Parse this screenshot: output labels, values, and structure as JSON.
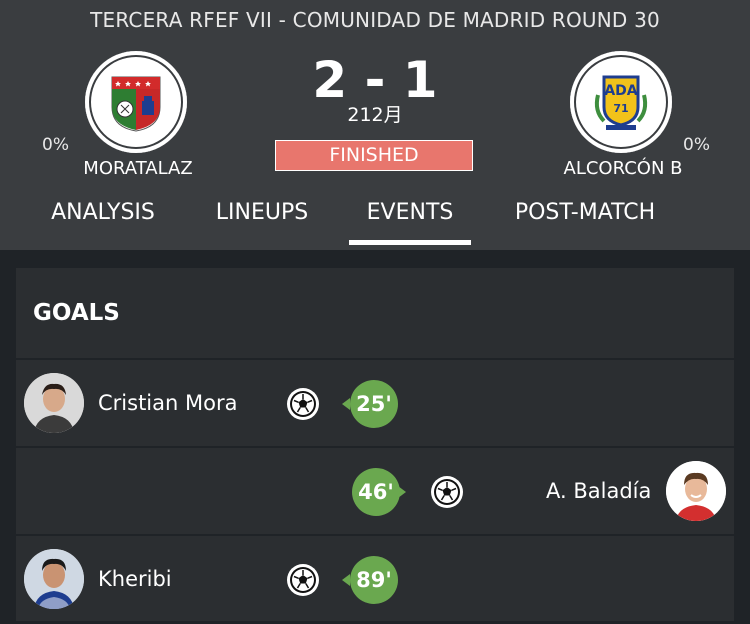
{
  "competition": {
    "title": "TERCERA RFEF  VII - COMUNIDAD DE MADRID ROUND 30"
  },
  "home": {
    "name": "MORATALAZ",
    "percent": "0%",
    "crest_icon": "moratalaz-crest"
  },
  "away": {
    "name": "ALCORCÓN B",
    "percent": "0%",
    "crest_icon": "alcorcon-crest"
  },
  "match": {
    "score": "2 - 1",
    "date": "212月",
    "status": "FINISHED"
  },
  "tabs": [
    {
      "label": "ANALYSIS"
    },
    {
      "label": "LINEUPS"
    },
    {
      "label": "EVENTS",
      "active": true
    },
    {
      "label": "POST-MATCH"
    }
  ],
  "events": {
    "section_title": "GOALS",
    "goals": [
      {
        "player": "Cristian Mora",
        "minute": "25'",
        "side": "home"
      },
      {
        "player": "A. Baladía",
        "minute": "46'",
        "side": "away"
      },
      {
        "player": "Kheribi",
        "minute": "89'",
        "side": "home"
      }
    ]
  },
  "colors": {
    "header_bg": "#3a3d40",
    "card_bg": "#2b2e31",
    "page_bg": "#1f2327",
    "finished_badge": "#e8766d",
    "minute_bubble": "#6aa84f"
  }
}
